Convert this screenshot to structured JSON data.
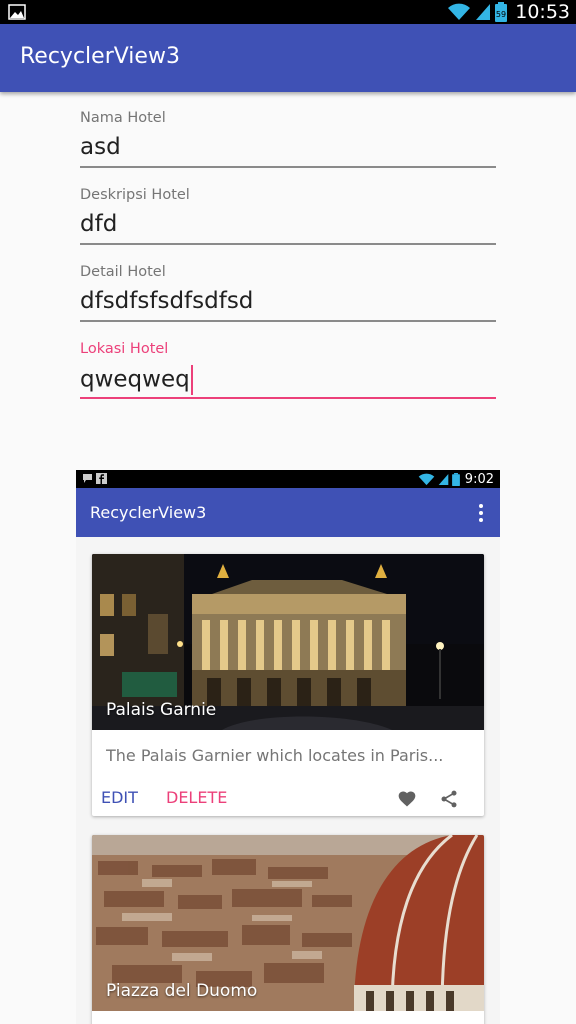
{
  "status_bar": {
    "time": "10:53",
    "battery_text": "59",
    "icons": [
      "image-notification-icon",
      "wifi-icon",
      "signal-icon",
      "battery-icon"
    ]
  },
  "app_bar": {
    "title": "RecyclerView3"
  },
  "form": {
    "fields": [
      {
        "label": "Nama Hotel",
        "value": "asd"
      },
      {
        "label": "Deskripsi Hotel",
        "value": "dfd"
      },
      {
        "label": "Detail Hotel",
        "value": "dfsdfsfsdfsdfsd"
      },
      {
        "label": "Lokasi Hotel",
        "value": "qweqweq"
      }
    ]
  },
  "preview": {
    "status_bar": {
      "time": "9:02"
    },
    "app_bar": {
      "title": "RecyclerView3"
    },
    "cards": [
      {
        "title": "Palais Garnie",
        "description": "The Palais Garnier which locates in Paris...",
        "edit_label": "EDIT",
        "delete_label": "DELETE"
      },
      {
        "title": "Piazza del Duomo"
      }
    ]
  },
  "colors": {
    "primary": "#3f51b5",
    "accent": "#ec407a",
    "status_bar": "#000000"
  }
}
